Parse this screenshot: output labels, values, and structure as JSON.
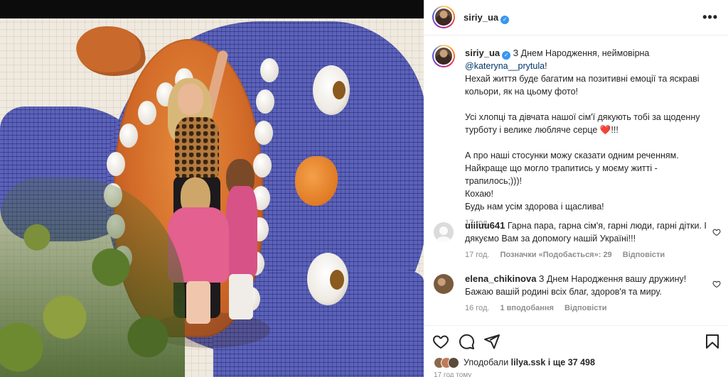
{
  "post": {
    "username": "siriy_ua",
    "verified_mark": "✓",
    "more_icon": "more-horizontal-icon"
  },
  "caption": {
    "username": "siriy_ua",
    "line1": " З Днем Народження, неймовірна",
    "mention": "@kateryna__prytula",
    "mention_suffix": "!",
    "line2": "Нехай життя буде багатим на позитивні емоції та яскраві кольори, як на цьому фото!",
    "line3": "Усі хлопці та дівчата нашої сім'ї дякують тобі за щоденну турботу і велике любляче серце",
    "heart": "❤️",
    "line3_suffix": "!!!",
    "line4": "А про наші стосунки можу сказати одним реченням.",
    "line5": "Найкраще що могло трапитись у моєму житті - трапилось;)))!",
    "line6": "Кохаю!",
    "line7": "Будь нам усім здорова і щаслива!",
    "time": "17 год."
  },
  "comments": [
    {
      "username": "uiiiuu641",
      "text": " Гарна пара, гарна сім'я, гарні люди, гарні дітки. І дякуємо Вам за допомогу нашій Україні!!!",
      "time": "17 год.",
      "likes": "Позначки «Подобається»: 29",
      "reply": "Відповісти"
    },
    {
      "username": "elena_chikinova",
      "text": " З Днем Народження вашу дружину! Бажаю вашій родині всіх благ, здоров'я та миру.",
      "time": "16 год.",
      "likes": "1 вподобання",
      "reply": "Відповісти"
    }
  ],
  "actions": {
    "like_icon": "heart-icon",
    "comment_icon": "comment-icon",
    "share_icon": "send-icon",
    "save_icon": "bookmark-icon"
  },
  "likes": {
    "prefix": "Уподобали ",
    "user": "lilya.ssk",
    "suffix": " і ще 37 498"
  },
  "footer_time": "17 год тому"
}
